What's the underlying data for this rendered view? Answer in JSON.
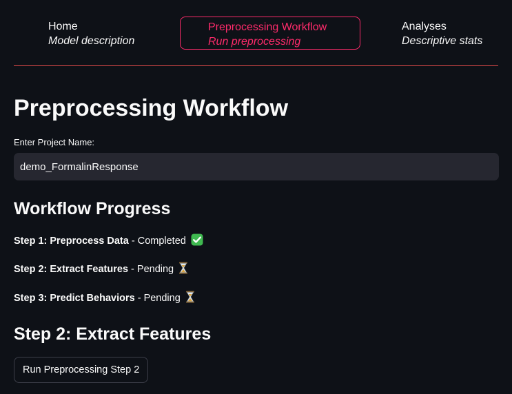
{
  "nav": {
    "items": [
      {
        "title": "Home",
        "subtitle": "Model description"
      },
      {
        "title": "Preprocessing Workflow",
        "subtitle": "Run preprocessing"
      },
      {
        "title": "Analyses",
        "subtitle": "Descriptive stats"
      }
    ],
    "active_color": "#ff2b6b",
    "divider_color": "#e04a4a"
  },
  "main": {
    "title": "Preprocessing Workflow",
    "project_label": "Enter Project Name:",
    "project_value": "demo_FormalinResponse",
    "progress_heading": "Workflow Progress",
    "steps": [
      {
        "label": "Step 1: Preprocess Data",
        "separator": " - ",
        "status": "Completed",
        "icon": "check-mark-icon"
      },
      {
        "label": "Step 2: Extract Features",
        "separator": " - ",
        "status": "Pending",
        "icon": "hourglass-icon"
      },
      {
        "label": "Step 3: Predict Behaviors",
        "separator": " - ",
        "status": "Pending",
        "icon": "hourglass-icon"
      }
    ],
    "current_step_heading": "Step 2: Extract Features",
    "run_button_label": "Run Preprocessing Step 2"
  },
  "colors": {
    "background": "#0e1117",
    "input_background": "#262730",
    "completed_green": "#3fb950",
    "hourglass_amber": "#d9a441"
  }
}
